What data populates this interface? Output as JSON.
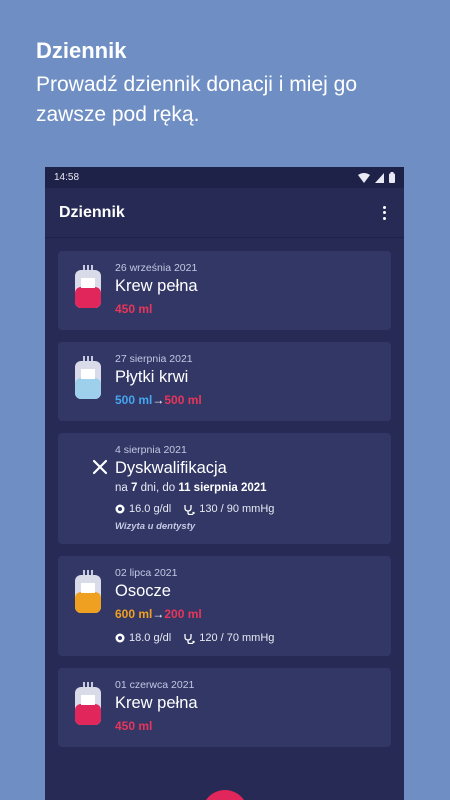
{
  "promo": {
    "title": "Dziennik",
    "subtitle": "Prowadź dziennik donacji i miej go zawsze pod ręką."
  },
  "status_bar": {
    "time": "14:58"
  },
  "app_bar": {
    "title": "Dziennik"
  },
  "entries": [
    {
      "date": "26 września 2021",
      "type": "Krew pełna",
      "volume": "450 ml",
      "bag_color": "#e0265a"
    },
    {
      "date": "27 sierpnia 2021",
      "type": "Płytki krwi",
      "volume_from": "500 ml",
      "arrow": "→",
      "volume_to": "500 ml",
      "bag_color": "#9ed0ec"
    },
    {
      "date": "4 sierpnia 2021",
      "type": "Dyskwalifikacja",
      "disq_prefix": "na ",
      "disq_days": "7",
      "disq_mid": " dni, do ",
      "disq_until": "11 sierpnia 2021",
      "hemoglobin": "16.0 g/dl",
      "pressure": "130 / 90 mmHg",
      "note": "Wizyta u dentysty"
    },
    {
      "date": "02 lipca 2021",
      "type": "Osocze",
      "volume_from": "600 ml",
      "arrow": "→",
      "volume_to": "200 ml",
      "hemoglobin": "18.0 g/dl",
      "pressure": "120 / 70 mmHg",
      "bag_color": "#f0a020"
    },
    {
      "date": "01 czerwca 2021",
      "type": "Krew pełna",
      "volume": "450 ml",
      "bag_color": "#e0265a"
    }
  ],
  "colors": {
    "background": "#6f8fc4",
    "surface": "#262a55",
    "card": "#323766",
    "accent": "#e0265a"
  }
}
